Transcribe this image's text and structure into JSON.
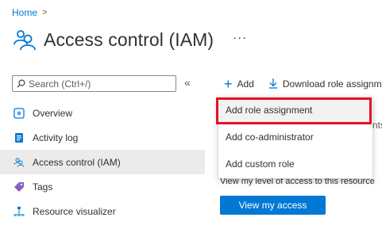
{
  "breadcrumb": {
    "home": "Home",
    "separator": ">"
  },
  "page": {
    "title": "Access control (IAM)",
    "more": "···"
  },
  "search": {
    "placeholder": "Search (Ctrl+/)",
    "collapse": "«"
  },
  "nav": [
    {
      "label": "Overview",
      "icon": "overview-icon"
    },
    {
      "label": "Activity log",
      "icon": "activity-log-icon"
    },
    {
      "label": "Access control (IAM)",
      "icon": "iam-icon",
      "active": true
    },
    {
      "label": "Tags",
      "icon": "tag-icon"
    },
    {
      "label": "Resource visualizer",
      "icon": "resource-visualizer-icon"
    }
  ],
  "toolbar": {
    "add_label": "Add",
    "download_label": "Download role assignments"
  },
  "menu": {
    "add_role_assignment": "Add role assignment",
    "add_co_admin": "Add co-administrator",
    "add_custom_role": "Add custom role"
  },
  "background": {
    "partial_text": "nts",
    "view_level": "View my level of access to this resource",
    "view_access_button": "View my access"
  },
  "colors": {
    "accent": "#0078d4",
    "highlight": "#e81123"
  }
}
